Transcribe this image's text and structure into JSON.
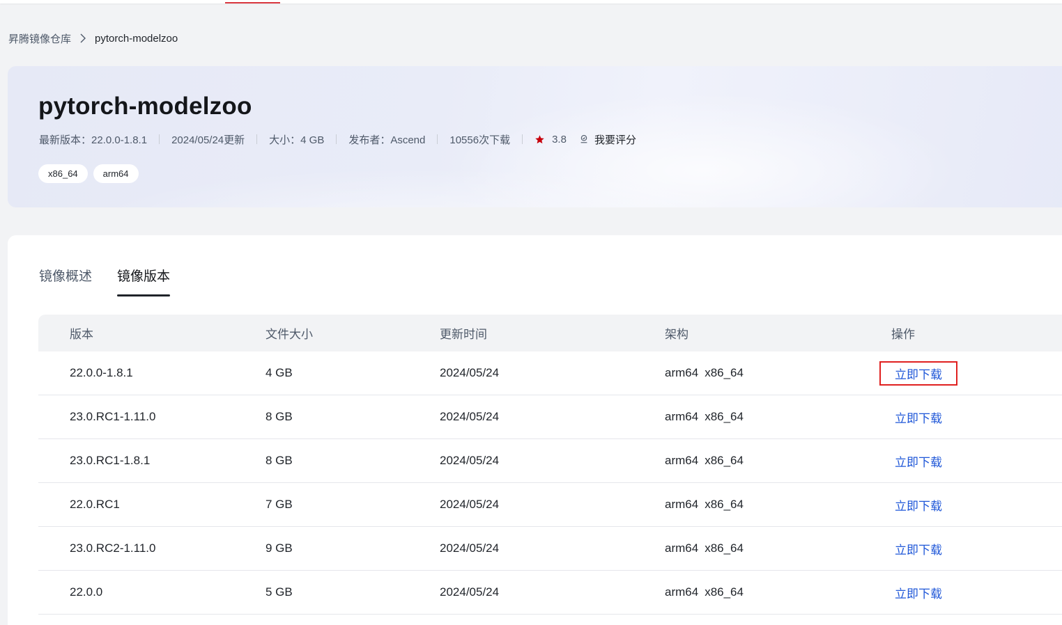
{
  "breadcrumb": {
    "root": "昇腾镜像仓库",
    "current": "pytorch-modelzoo"
  },
  "hero": {
    "title": "pytorch-modelzoo",
    "latest_version": "最新版本：22.0.0-1.8.1",
    "updated": "2024/05/24更新",
    "size": "大小：4 GB",
    "publisher": "发布者：Ascend",
    "downloads": "10556次下载",
    "rating": "3.8",
    "rate_label": "我要评分",
    "tags": [
      "x86_64",
      "arm64"
    ],
    "colors": {
      "star": "#c7000b"
    }
  },
  "tabs": [
    {
      "label": "镜像概述",
      "active": false
    },
    {
      "label": "镜像版本",
      "active": true
    }
  ],
  "table": {
    "columns": [
      "版本",
      "文件大小",
      "更新时间",
      "架构",
      "操作"
    ],
    "action_color": "#1f57d8",
    "rows": [
      {
        "version": "22.0.0-1.8.1",
        "size": "4 GB",
        "updated": "2024/05/24",
        "arch": [
          "arm64",
          "x86_64"
        ],
        "action": "立即下载",
        "highlighted": true
      },
      {
        "version": "23.0.RC1-1.11.0",
        "size": "8 GB",
        "updated": "2024/05/24",
        "arch": [
          "arm64",
          "x86_64"
        ],
        "action": "立即下载",
        "highlighted": false
      },
      {
        "version": "23.0.RC1-1.8.1",
        "size": "8 GB",
        "updated": "2024/05/24",
        "arch": [
          "arm64",
          "x86_64"
        ],
        "action": "立即下载",
        "highlighted": false
      },
      {
        "version": "22.0.RC1",
        "size": "7 GB",
        "updated": "2024/05/24",
        "arch": [
          "arm64",
          "x86_64"
        ],
        "action": "立即下载",
        "highlighted": false
      },
      {
        "version": "23.0.RC2-1.11.0",
        "size": "9 GB",
        "updated": "2024/05/24",
        "arch": [
          "arm64",
          "x86_64"
        ],
        "action": "立即下载",
        "highlighted": false
      },
      {
        "version": "22.0.0",
        "size": "5 GB",
        "updated": "2024/05/24",
        "arch": [
          "arm64",
          "x86_64"
        ],
        "action": "立即下载",
        "highlighted": false
      }
    ]
  }
}
